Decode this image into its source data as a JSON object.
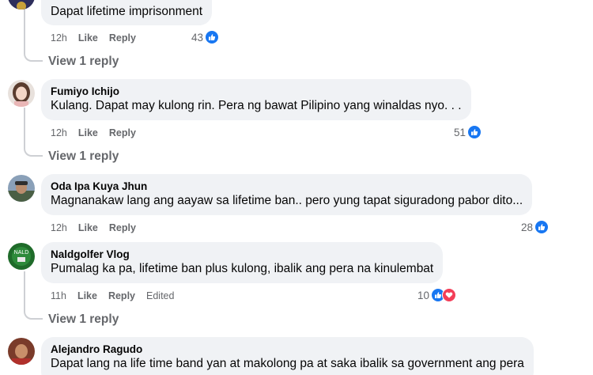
{
  "comments": [
    {
      "text": "Dapat lifetime imprisonment",
      "time": "12h",
      "like_label": "Like",
      "reply_label": "Reply",
      "reaction_count": "43",
      "reactions": [
        "like-icon"
      ],
      "view_replies": "View 1 reply"
    },
    {
      "author": "Fumiyo Ichijo",
      "text": "Kulang. Dapat may kulong rin. Pera ng bawat Pilipino yang winaldas nyo. . .",
      "time": "12h",
      "like_label": "Like",
      "reply_label": "Reply",
      "reaction_count": "51",
      "reactions": [
        "like-icon"
      ],
      "view_replies": "View 1 reply"
    },
    {
      "author": "Oda Ipa Kuya Jhun",
      "text": "Magnanakaw lang ang aayaw sa lifetime ban.. pero yung tapat siguradong pabor dito...",
      "time": "12h",
      "like_label": "Like",
      "reply_label": "Reply",
      "reaction_count": "28",
      "reactions": [
        "like-icon"
      ]
    },
    {
      "author": "Naldgolfer Vlog",
      "text": "Pumalag ka pa, lifetime ban plus kulong, ibalik ang pera na kinulembat",
      "time": "11h",
      "like_label": "Like",
      "reply_label": "Reply",
      "edited_label": "Edited",
      "reaction_count": "10",
      "reactions": [
        "like-icon",
        "heart-icon"
      ],
      "view_replies": "View 1 reply"
    },
    {
      "author": "Alejandro Ragudo",
      "text": "Dapat lang na life time band yan at makolong pa at saka ibalik sa government ang pera"
    }
  ],
  "colors": {
    "bubble": "#f0f2f5",
    "meta": "#65676b",
    "like_blue": "#1877f2",
    "love_red": "#f33e58",
    "thread_line": "#ced0d4"
  }
}
